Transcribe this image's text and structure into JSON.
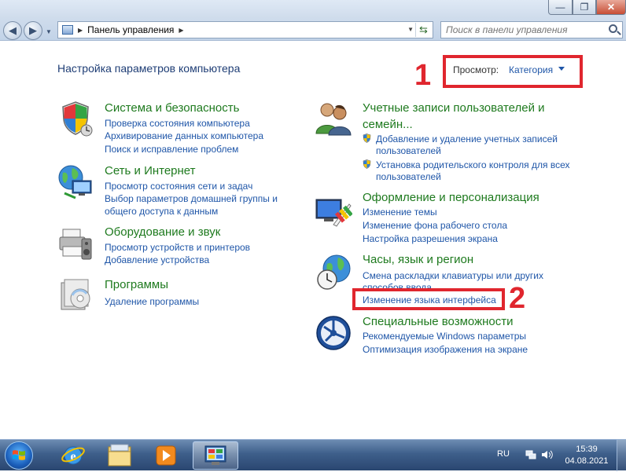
{
  "window": {
    "minimize_glyph": "—",
    "maximize_glyph": "❐",
    "close_glyph": "✕"
  },
  "navigation": {
    "back_glyph": "◀",
    "forward_glyph": "▶",
    "refresh_glyph": "⇆"
  },
  "address_bar": {
    "path": [
      "Панель управления"
    ]
  },
  "search": {
    "placeholder": "Поиск в панели управления"
  },
  "main": {
    "title": "Настройка параметров компьютера",
    "view_label": "Просмотр:",
    "view_value": "Категория"
  },
  "annotations": {
    "mark_1": "1",
    "mark_2": "2"
  },
  "categories": {
    "system": {
      "icon": "system-security-shield-icon",
      "title": "Система и безопасность",
      "links": [
        "Проверка состояния компьютера",
        "Архивирование данных компьютера",
        "Поиск и исправление проблем"
      ]
    },
    "network": {
      "icon": "network-globe-icon",
      "title": "Сеть и Интернет",
      "links": [
        "Просмотр состояния сети и задач",
        "Выбор параметров домашней группы и",
        "общего доступа к данным"
      ]
    },
    "hardware": {
      "icon": "printer-sound-icon",
      "title": "Оборудование и звук",
      "links": [
        "Просмотр устройств и принтеров",
        "Добавление устройства"
      ]
    },
    "programs": {
      "icon": "programs-box-icon",
      "title": "Программы",
      "links": [
        "Удаление программы"
      ]
    },
    "accounts": {
      "icon": "user-accounts-icon",
      "title_line1": "Учетные записи пользователей и",
      "title_line2": "семейн...",
      "links": [
        "Добавление и удаление учетных записей",
        "пользователей",
        "Установка родительского контроля для всех",
        "пользователей"
      ]
    },
    "appearance": {
      "icon": "appearance-monitor-icon",
      "title": "Оформление и персонализация",
      "links": [
        "Изменение темы",
        "Изменение фона рабочего стола",
        "Настройка разрешения экрана"
      ]
    },
    "clock": {
      "icon": "clock-globe-icon",
      "title": "Часы, язык и регион",
      "links": [
        "Смена раскладки клавиатуры или других",
        "способов ввода",
        "Изменение языка интерфейса"
      ]
    },
    "access": {
      "icon": "ease-of-access-icon",
      "title": "Специальные возможности",
      "links": [
        "Рекомендуемые Windows параметры",
        "Оптимизация изображения на экране"
      ]
    }
  },
  "taskbar": {
    "items": [
      "start-orb-icon",
      "internet-explorer-icon",
      "explorer-folder-icon",
      "media-player-icon",
      "control-panel-icon"
    ],
    "language": "RU",
    "time": "15:39",
    "date": "04.08.2021"
  },
  "colors": {
    "category_title": "#1e7a1e",
    "link": "#1f56a8",
    "annotation": "#e0262e",
    "taskbar": "#3e5f8b"
  }
}
